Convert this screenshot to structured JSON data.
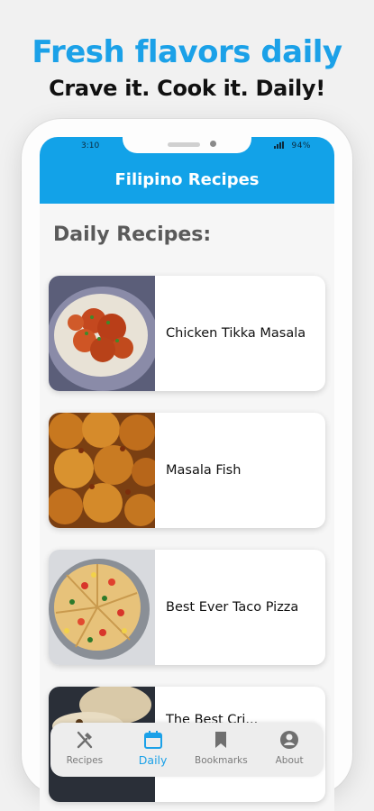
{
  "promo": {
    "headline": "Fresh flavors daily",
    "subline": "Crave it. Cook it. Daily!"
  },
  "status_bar": {
    "time": "3:10",
    "indicators": "94%"
  },
  "app_bar": {
    "title": "Filipino Recipes"
  },
  "section": {
    "title": "Daily Recipes:"
  },
  "recipes": [
    {
      "title": "Chicken Tikka Masala",
      "image_icon": "curry-dish-image"
    },
    {
      "title": "Masala Fish",
      "image_icon": "fried-fish-image"
    },
    {
      "title": "Best Ever Taco Pizza",
      "image_icon": "pizza-image"
    },
    {
      "title": "The Best Cri...",
      "image_icon": "baked-dish-image"
    }
  ],
  "bottom_nav": {
    "active": "Daily",
    "items": [
      {
        "label": "Recipes",
        "icon": "utensils-icon"
      },
      {
        "label": "Daily",
        "icon": "calendar-icon"
      },
      {
        "label": "Bookmarks",
        "icon": "bookmark-icon"
      },
      {
        "label": "About",
        "icon": "account-icon"
      }
    ]
  },
  "colors": {
    "accent": "#1BA1E8",
    "appbar": "#12A2E8",
    "card": "#FFFFFF",
    "background": "#F1F1F1"
  }
}
